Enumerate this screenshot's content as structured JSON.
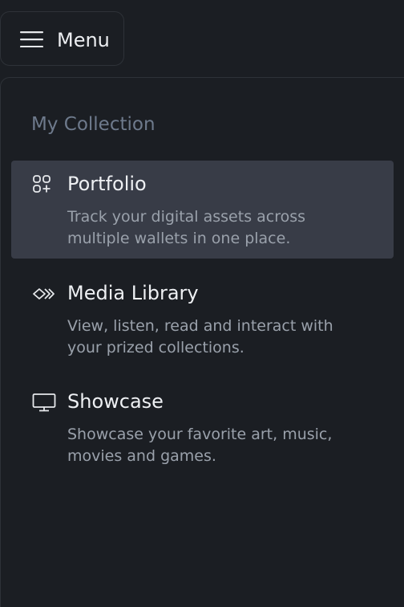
{
  "menu_button": {
    "label": "Menu",
    "icon": "hamburger-icon"
  },
  "section": {
    "title": "My Collection"
  },
  "items": [
    {
      "icon": "grid-plus-icon",
      "title": "Portfolio",
      "description": "Track your digital assets across multiple wallets in one place.",
      "active": true
    },
    {
      "icon": "chevrons-icon",
      "title": "Media Library",
      "description": "View, listen, read and interact with your prized collections.",
      "active": false
    },
    {
      "icon": "monitor-icon",
      "title": "Showcase",
      "description": "Showcase your favorite art, music, movies and games.",
      "active": false
    }
  ],
  "colors": {
    "background": "#1b1e23",
    "active_item": "#383c47",
    "section_title": "#6e7a8c",
    "description": "#9aa1ab"
  }
}
